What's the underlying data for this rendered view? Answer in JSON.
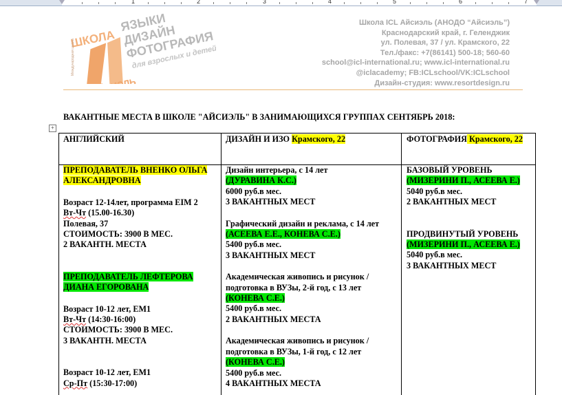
{
  "ruler": {
    "numbers": [
      "1",
      "2",
      "3",
      "4",
      "5",
      "6",
      "7"
    ]
  },
  "logo": {
    "shkola": "ШКОЛА",
    "aiseel": "АЙСИЭЛЬ",
    "line1": "ЯЗЫКИ",
    "line2": "ДИЗАЙН",
    "line3": "ФОТОГРАФИЯ",
    "line4": "для взрослых и детей",
    "side": "Международная школа",
    "color_brand": "#e87722"
  },
  "header": {
    "address_lines": [
      "Школа ICL Айсиэль (АНОДО “Айсиэль”)",
      "Краснодарский край, г. Геленджик",
      "ул. Полевая, 37 / ул. Крамского, 22",
      "Тел./факс: +7(86141) 500-18; 560-60",
      "school@icl-international.ru; www.icl-international.ru",
      "@iclacademy; FB:ICLschool/VK:ICLschool",
      "Дизайн-студия: www.resortdesign.ru"
    ]
  },
  "title": "ВАКАНТНЫЕ МЕСТА В ШКОЛЕ \"АЙСИЭЛЬ\" В ЗАНИМАЮЩИХСЯ ГРУППАХ СЕНТЯБРЬ 2018:",
  "table": {
    "headers": {
      "english": "АНГЛИЙСКИЙ",
      "design_prefix": "ДИЗАЙН И ИЗО ",
      "design_addr": "Крамского, 22",
      "photo_prefix": "ФОТОГРАФИЯ",
      "photo_addr": " Крамского, 22"
    },
    "english": {
      "teacher1": "ПРЕПОДАВАТЕЛЬ ВНЕНКО ОЛЬГА АЛЕКСАНДРОВНА",
      "g1_age": "Возраст 12-14лет, программа EIM 2",
      "g1_days": "Вт-Чт",
      "g1_time": " (15.00-16.30)",
      "g1_place": "Полевая, 37",
      "g1_cost": "СТОИМОСТЬ:   3900 В МЕС.",
      "g1_places": "2 ВАКАНТН.  МЕСТА",
      "teacher2": "ПРЕПОДАВАТЕЛЬ ЛЕФТЕРОВА ДИАНА ЕГОРОВАНА",
      "g2_age": "Возраст 10-12 лет, EM1",
      "g2_days": "Вт-Чт",
      "g2_time": " (14:30-16:00)",
      "g2_cost": "СТОИМОСТЬ:   3900 В МЕС.",
      "g2_places": "3 ВАКАНТН.  МЕСТА",
      "g3_age": "Возраст 10-12 лет, EM1",
      "g3_days": "Ср-Пт",
      "g3_time": " (15:30-17:00)"
    },
    "design": {
      "c1_name": "Дизайн интерьера, с 14 лет",
      "c1_teacher": "(ДУРАВИНА К.С.)",
      "c1_price": "6000 руб.в мес.",
      "c1_places": "3 ВАКАНТНЫХ  МЕСТ",
      "c2_name": "Графический дизайн и реклама, с 14 лет",
      "c2_teacher": "(АСЕЕВА Е.Е., КОНЕВА С.Е.)",
      "c2_price": "5400 руб.в мес.",
      "c2_places": "3 ВАКАНТНЫХ  МЕСТ",
      "c3_name1": "Академическая живопись и рисунок /",
      "c3_name2": "подготовка в ВУЗы, 2-й год, с 13 лет",
      "c3_teacher": "(КОНЕВА С.Е.)",
      "c3_price": "5400 руб.в мес.",
      "c3_places": "2 ВАКАНТНЫХ  МЕСТА",
      "c4_name1": "Академическая живопись и рисунок /",
      "c4_name2": "подготовка в ВУЗы, 1-й год, с 12 лет",
      "c4_teacher": "(КОНЕВА С.Е.)",
      "c4_price": "5400 руб.в мес.",
      "c4_places": "4  ВАКАНТНЫХ  МЕСТА"
    },
    "photo": {
      "basic_title": "БАЗОВЫЙ УРОВЕНЬ",
      "basic_teacher": "(МИЗЕРИНИ П., АСЕЕВА Е.)",
      "basic_price": "5040 руб.в мес.",
      "basic_places": "2 ВАКАНТНЫХ  МЕСТ",
      "adv_title": "ПРОДВИНУТЫЙ УРОВЕНЬ",
      "adv_teacher": "(МИЗЕРИНИ П., АСЕЕВА Е.)",
      "adv_price": "5040 руб.в мес.",
      "adv_places": "3 ВАКАНТНЫХ  МЕСТ"
    }
  }
}
